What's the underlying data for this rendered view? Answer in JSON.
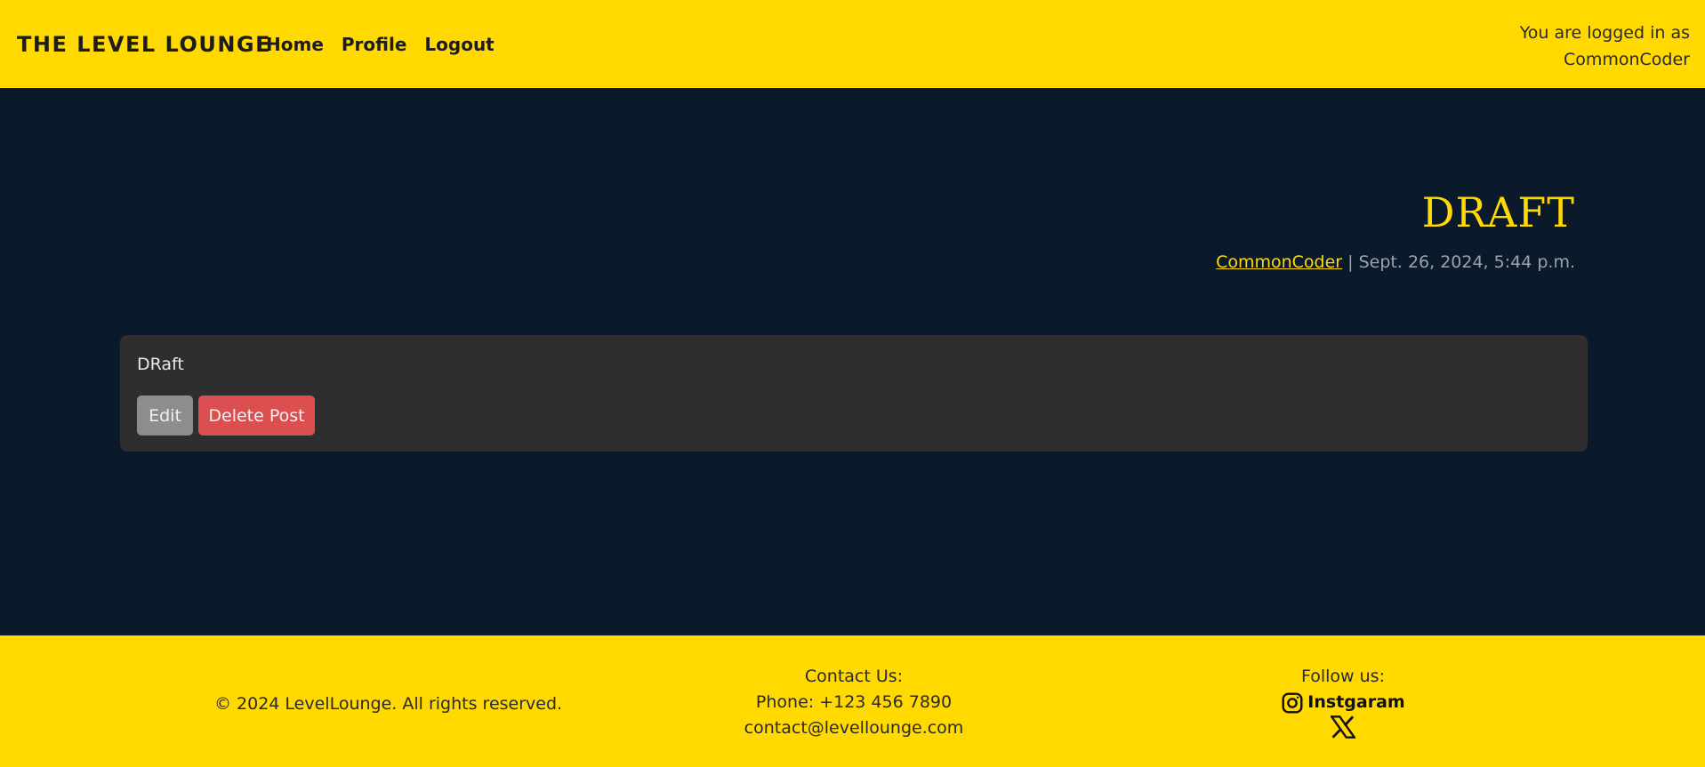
{
  "navbar": {
    "brand": "THE LEVEL LOUNGE",
    "links": [
      "Home",
      "Profile",
      "Logout"
    ],
    "login_line1": "You are logged in as",
    "login_user": "CommonCoder"
  },
  "post": {
    "title": "DRAFT",
    "author": "CommonCoder",
    "separator": " | ",
    "date": "Sept. 26, 2024, 5:44 p.m.",
    "body": "DRaft",
    "edit_label": "Edit",
    "delete_label": "Delete Post"
  },
  "footer": {
    "copyright": "© 2024 LevelLounge. All rights reserved.",
    "contact_heading": "Contact Us:",
    "phone": "Phone: +123 456 7890",
    "email": "contact@levellounge.com",
    "follow_heading": "Follow us:",
    "instagram_label": "Instgaram",
    "social_icons": [
      "instagram-icon",
      "x-icon"
    ]
  },
  "colors": {
    "accent": "#ffd900",
    "background": "#0a1a2b",
    "card": "#2e2e2e",
    "edit_button": "#8d8d8d",
    "delete_button": "#dc4f50"
  }
}
